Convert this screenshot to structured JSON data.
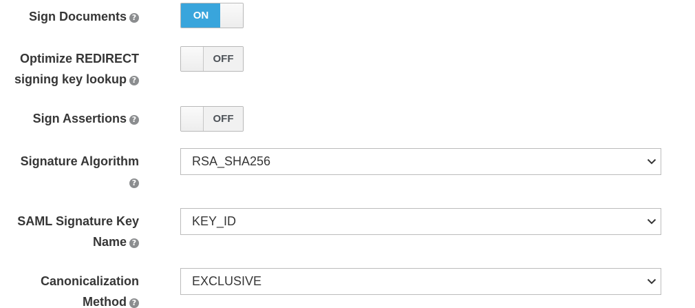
{
  "fields": {
    "sign_documents": {
      "label": "Sign Documents",
      "help": "?",
      "toggle": "ON"
    },
    "optimize_redirect": {
      "label_line1": "Optimize REDIRECT",
      "label_line2": "signing key lookup",
      "help": "?",
      "toggle": "OFF"
    },
    "sign_assertions": {
      "label": "Sign Assertions",
      "help": "?",
      "toggle": "OFF"
    },
    "signature_algorithm": {
      "label": "Signature Algorithm",
      "help": "?",
      "value": "RSA_SHA256"
    },
    "saml_signature_key_name": {
      "label_line1": "SAML Signature Key",
      "label_line2": "Name",
      "help": "?",
      "value": "KEY_ID"
    },
    "canonicalization_method": {
      "label_line1": "Canonicalization",
      "label_line2": "Method",
      "help": "?",
      "value": "EXCLUSIVE"
    }
  },
  "icons": {
    "help": "question-circle-icon",
    "dropdown": "chevron-down-icon"
  },
  "colors": {
    "toggle_on": "#39a5dc",
    "label": "#363636",
    "help_icon": "#8b8d8f"
  }
}
